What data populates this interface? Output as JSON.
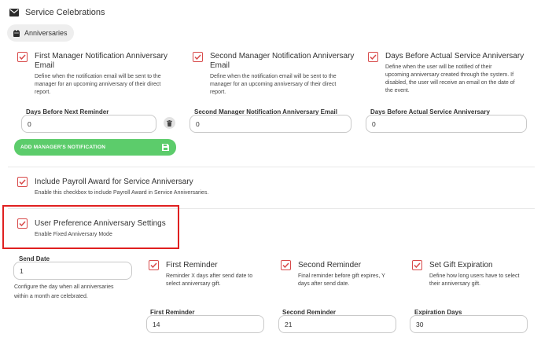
{
  "header": {
    "title": "Service Celebrations",
    "icon": "envelope-icon"
  },
  "tab": {
    "label": "Anniversaries",
    "icon": "calendar-icon"
  },
  "colors": {
    "accent": "#d84a4a",
    "green": "#5ccc6b",
    "highlight": "#e02020"
  },
  "top_options": [
    {
      "title_line1": "First Manager Notification Anniversary",
      "title_line2": "Email",
      "desc": [
        "Define when the notification email will be sent to the",
        "manager for an upcoming anniversary of their direct",
        "report."
      ],
      "checked": true
    },
    {
      "title_line1": "Second Manager Notification Anniversary",
      "title_line2": "Email",
      "desc": [
        "Define when the notification email will be sent to the",
        "manager for an upcoming anniversary of their direct",
        "report."
      ],
      "checked": true
    },
    {
      "title_line1": "Days Before Actual Service Anniversary",
      "title_line2": "",
      "desc": [
        "Define when the user will be notified of their",
        "upcoming anniversary created through the system. If",
        "disabled, the user will receive an email on the date of",
        "the event."
      ],
      "checked": true
    }
  ],
  "top_fields": [
    {
      "label": "Days Before Next Reminder",
      "value": "0"
    },
    {
      "label": "Second Manager Notification Anniversary Email",
      "value": "0"
    },
    {
      "label": "Days Before Actual Service Anniversary",
      "value": "0"
    }
  ],
  "add_button": {
    "label": "ADD MANAGER'S NOTIFICATION"
  },
  "payroll": {
    "title": "Include Payroll Award for Service Anniversary",
    "desc": "Enable this checkbox to include Payroll Award in Service Anniversaries.",
    "checked": true
  },
  "user_pref": {
    "title": "User Preference Anniversary Settings",
    "desc": "Enable Fixed Anniversary Mode",
    "checked": true
  },
  "send_date": {
    "label": "Send Date",
    "value": "1",
    "help": [
      "Configure the day when all anniversaries",
      "within a month are celebrated."
    ]
  },
  "bottom_options": [
    {
      "title": "First Reminder",
      "desc": [
        "Reminder X days after send date to",
        "select anniversary gift."
      ],
      "checked": true
    },
    {
      "title": "Second Reminder",
      "desc": [
        "Final reminder before gift expires, Y",
        "days after send date."
      ],
      "checked": true
    },
    {
      "title": "Set Gift Expiration",
      "desc": [
        "Define how long users have to select",
        "their anniversary gift."
      ],
      "checked": true
    }
  ],
  "bottom_fields": [
    {
      "label": "First Reminder",
      "value": "14"
    },
    {
      "label": "Second Reminder",
      "value": "21"
    },
    {
      "label": "Expiration Days",
      "value": "30"
    }
  ]
}
